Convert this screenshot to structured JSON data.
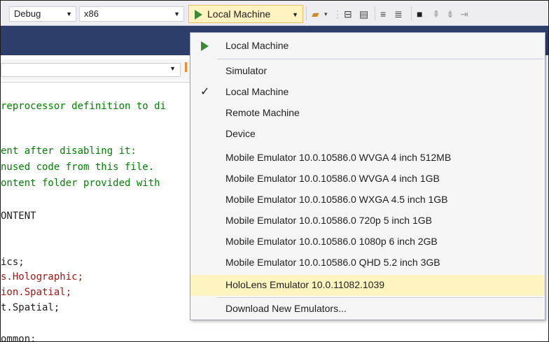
{
  "toolbar": {
    "config_value": "Debug",
    "platform_value": "x86",
    "run_target": "Local Machine"
  },
  "code_lines": [
    {
      "text": "reprocessor definition to di",
      "color": "green"
    },
    {
      "text": "ent after disabling it:",
      "color": "green"
    },
    {
      "text": "nused code from this file.",
      "color": "green"
    },
    {
      "text": "ontent folder provided with",
      "color": "green"
    },
    {
      "text": "ONTENT",
      "color": "dark"
    },
    {
      "text": "ics;",
      "color": "dark"
    },
    {
      "text": "s.Holographic;",
      "color": "red"
    },
    {
      "text": "ion.Spatial;",
      "color": "red"
    },
    {
      "text": "t.Spatial;",
      "color": "dark"
    },
    {
      "text": "ommon;",
      "color": "dark"
    }
  ],
  "menu": {
    "items": [
      {
        "label": "Local Machine",
        "icon": "play-icon",
        "highlighted": false,
        "checked": false
      },
      {
        "label": "Simulator",
        "icon": "",
        "highlighted": false,
        "checked": false
      },
      {
        "label": "Local Machine",
        "icon": "check-icon",
        "highlighted": false,
        "checked": true
      },
      {
        "label": "Remote Machine",
        "icon": "",
        "highlighted": false,
        "checked": false
      },
      {
        "label": "Device",
        "icon": "",
        "highlighted": false,
        "checked": false
      },
      {
        "label": "Mobile Emulator 10.0.10586.0 WVGA 4 inch 512MB",
        "icon": "",
        "highlighted": false,
        "checked": false
      },
      {
        "label": "Mobile Emulator 10.0.10586.0 WVGA 4 inch 1GB",
        "icon": "",
        "highlighted": false,
        "checked": false
      },
      {
        "label": "Mobile Emulator 10.0.10586.0 WXGA 4.5 inch 1GB",
        "icon": "",
        "highlighted": false,
        "checked": false
      },
      {
        "label": "Mobile Emulator 10.0.10586.0 720p 5 inch 1GB",
        "icon": "",
        "highlighted": false,
        "checked": false
      },
      {
        "label": "Mobile Emulator 10.0.10586.0 1080p 6 inch 2GB",
        "icon": "",
        "highlighted": false,
        "checked": false
      },
      {
        "label": "Mobile Emulator 10.0.10586.0 QHD 5.2 inch 3GB",
        "icon": "",
        "highlighted": false,
        "checked": false
      },
      {
        "label": "HoloLens Emulator 10.0.11082.1039",
        "icon": "",
        "highlighted": true,
        "checked": false
      },
      {
        "label": "Download New Emulators...",
        "icon": "",
        "highlighted": false,
        "checked": false
      }
    ]
  },
  "colors": {
    "accent_green": "#388a34",
    "highlight": "#fdf4c0",
    "tab_band": "#2d3e6b",
    "code_comment": "#008000",
    "code_namespace": "#a31515"
  }
}
